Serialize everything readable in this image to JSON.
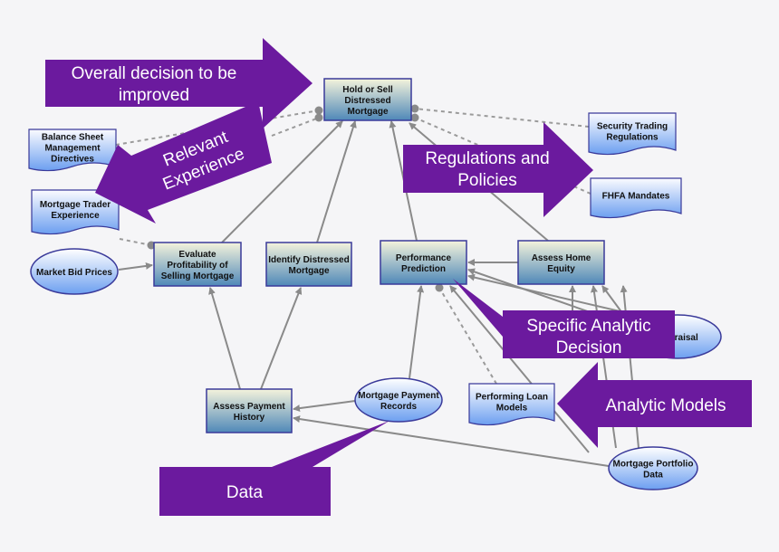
{
  "colors": {
    "purple": "#6b1a9e",
    "edge": "#8a8a8a",
    "node_border": "#3a3a9a"
  },
  "nodes": {
    "hold": {
      "lines": [
        "Hold or Sell",
        "Distressed",
        "Mortgage"
      ],
      "kind": "decision"
    },
    "security": {
      "lines": [
        "Security Trading",
        "Regulations"
      ],
      "kind": "document"
    },
    "fhfa": {
      "lines": [
        "FHFA Mandates"
      ],
      "kind": "document"
    },
    "balance": {
      "lines": [
        "Balance Sheet",
        "Management",
        "Directives"
      ],
      "kind": "document"
    },
    "trader": {
      "lines": [
        "Mortgage Trader",
        "Experience"
      ],
      "kind": "document"
    },
    "market": {
      "lines": [
        "Market Bid Prices"
      ],
      "kind": "data"
    },
    "evaluate": {
      "lines": [
        "Evaluate",
        "Profitability of",
        "Selling Mortgage"
      ],
      "kind": "decision"
    },
    "identify": {
      "lines": [
        "Identify Distressed",
        "Mortgage"
      ],
      "kind": "decision"
    },
    "performance": {
      "lines": [
        "Performance",
        "Prediction"
      ],
      "kind": "decision"
    },
    "equity": {
      "lines": [
        "Assess Home",
        "Equity"
      ],
      "kind": "decision"
    },
    "appraisal": {
      "lines": [
        "Appraisal"
      ],
      "kind": "data"
    },
    "loanmodels": {
      "lines": [
        "Performing Loan",
        "Models"
      ],
      "kind": "document"
    },
    "payhist": {
      "lines": [
        "Assess Payment",
        "History"
      ],
      "kind": "decision"
    },
    "payrec": {
      "lines": [
        "Mortgage Payment",
        "Records"
      ],
      "kind": "data"
    },
    "portfolio": {
      "lines": [
        "Mortgage Portfolio",
        "Data"
      ],
      "kind": "data"
    }
  },
  "callouts": {
    "overall": [
      "Overall decision to be",
      "improved"
    ],
    "experience": [
      "Relevant",
      "Experience"
    ],
    "regulations": [
      "Regulations and",
      "Policies"
    ],
    "specific": [
      "Specific Analytic",
      "Decision"
    ],
    "models": [
      "Analytic Models"
    ],
    "data": [
      "Data"
    ]
  }
}
